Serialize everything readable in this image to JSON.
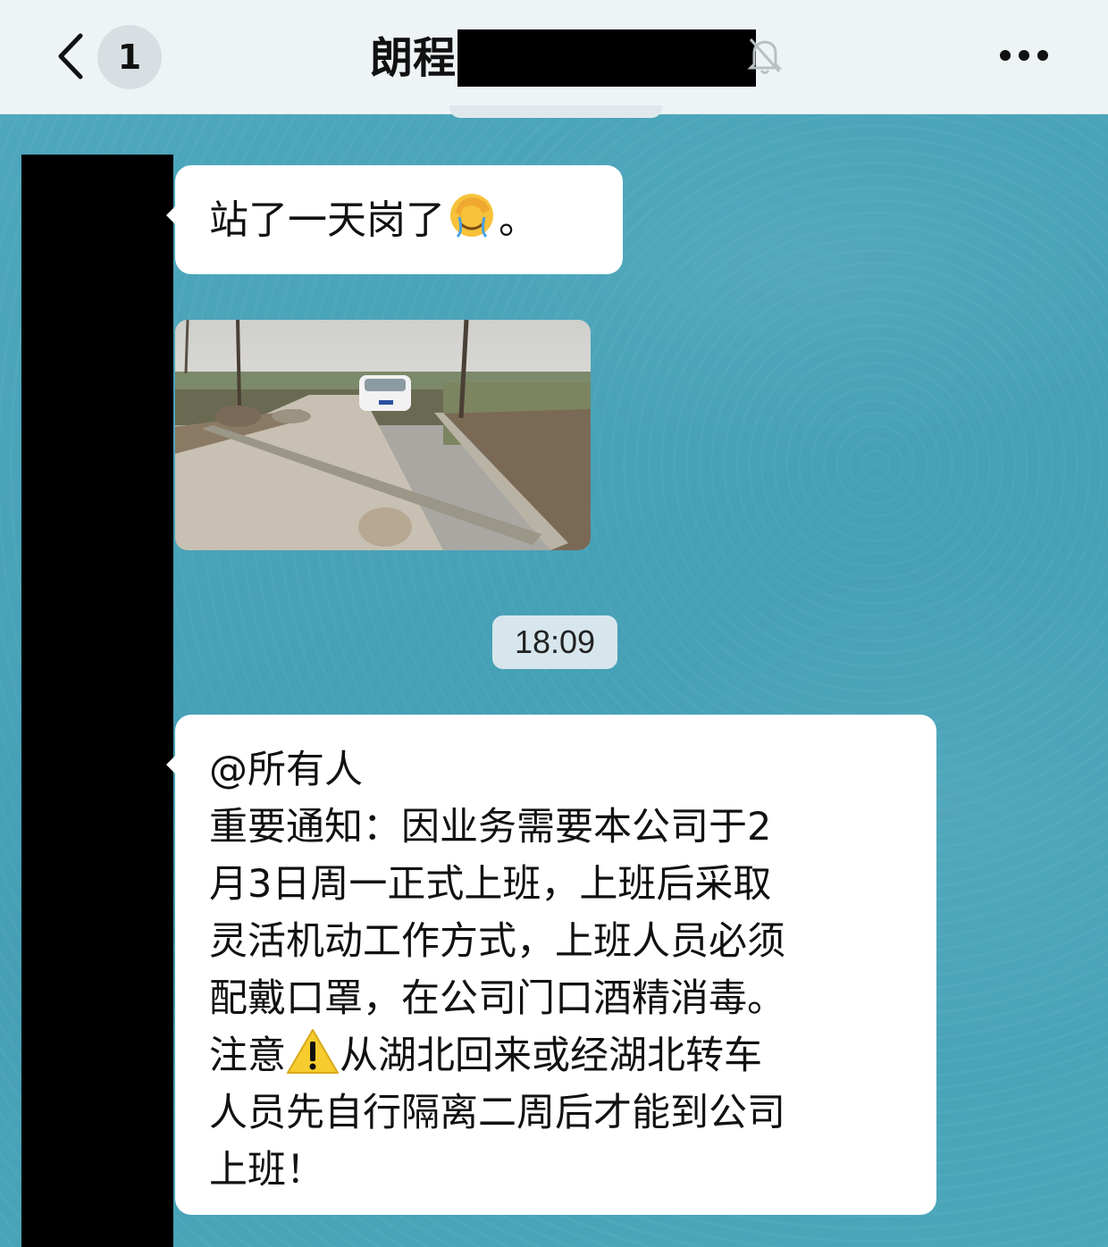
{
  "header": {
    "back_badge": "1",
    "title": "朗程",
    "title_redacted": true
  },
  "messages": [
    {
      "type": "text",
      "text_before_emoji": "站了一天岗了",
      "emoji": "face-palm-emoji",
      "text_after_emoji": "。"
    },
    {
      "type": "image",
      "description_icon": "photo-road-with-car"
    }
  ],
  "timestamp": "18:09",
  "notice": {
    "lines": [
      "@所有人",
      "重要通知：因业务需要本公司于2",
      "月3日周一正式上班，上班后采取",
      "灵活机动工作方式，上班人员必须",
      "配戴口罩，在公司门口酒精消毒。"
    ],
    "warn_prefix": "注意",
    "warn_icon": "warning-icon",
    "warn_suffix": "从湖北回来或经湖北转车",
    "tail_lines": [
      "人员先自行隔离二周后才能到公司",
      "上班！"
    ]
  },
  "colors": {
    "header_bg": "#eef4f6",
    "wallpaper": "#4aa3b8",
    "bubble": "#ffffff",
    "time_pill": "#d6e6ec"
  }
}
